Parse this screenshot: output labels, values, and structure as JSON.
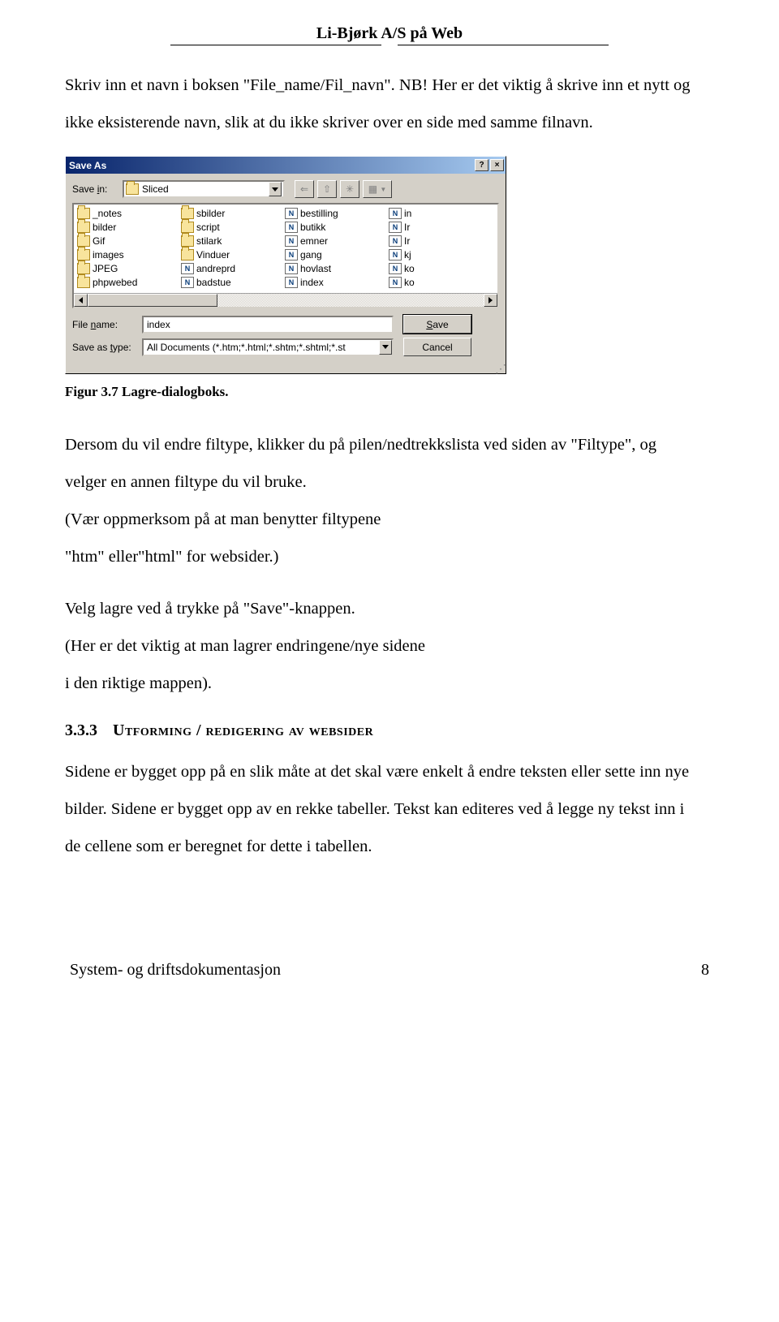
{
  "header": {
    "title": "Li-Bjørk A/S på Web"
  },
  "intro": {
    "p1": "Skriv inn et navn i boksen \"File_name/Fil_navn\". NB! Her er det viktig å skrive inn et nytt og",
    "p2": "ikke eksisterende navn, slik at du ikke skriver over en side med samme filnavn."
  },
  "dialog": {
    "title": "Save As",
    "help": "?",
    "close": "×",
    "savein_label_pre": "Save ",
    "savein_label_u": "i",
    "savein_label_post": "n:",
    "savein_value": "Sliced",
    "toolbar": {
      "back": "⇐",
      "up": "⇧",
      "new": "✳",
      "view": "▦"
    },
    "cols": [
      [
        {
          "t": "folder",
          "n": "_notes"
        },
        {
          "t": "folder",
          "n": "bilder"
        },
        {
          "t": "folder",
          "n": "Gif"
        },
        {
          "t": "folder",
          "n": "images"
        },
        {
          "t": "folder",
          "n": "JPEG"
        },
        {
          "t": "folder",
          "n": "phpwebed"
        }
      ],
      [
        {
          "t": "folder",
          "n": "sbilder"
        },
        {
          "t": "folder",
          "n": "script"
        },
        {
          "t": "folder",
          "n": "stilark"
        },
        {
          "t": "folder",
          "n": "Vinduer"
        },
        {
          "t": "file",
          "n": "andreprd"
        },
        {
          "t": "file",
          "n": "badstue"
        }
      ],
      [
        {
          "t": "file",
          "n": "bestilling"
        },
        {
          "t": "file",
          "n": "butikk"
        },
        {
          "t": "file",
          "n": "emner"
        },
        {
          "t": "file",
          "n": "gang"
        },
        {
          "t": "file",
          "n": "hovlast"
        },
        {
          "t": "file",
          "n": "index"
        }
      ],
      [
        {
          "t": "file",
          "n": "in"
        },
        {
          "t": "file",
          "n": "Ir"
        },
        {
          "t": "file",
          "n": "Ir"
        },
        {
          "t": "file",
          "n": "kj"
        },
        {
          "t": "file",
          "n": "ko"
        },
        {
          "t": "file",
          "n": "ko"
        }
      ]
    ],
    "filename_label_pre": "File ",
    "filename_label_u": "n",
    "filename_label_post": "ame:",
    "filename_value": "index",
    "type_label_pre": "Save as ",
    "type_label_u": "t",
    "type_label_post": "ype:",
    "type_value": "All Documents (*.htm;*.html;*.shtm;*.shtml;*.st",
    "save_btn_u": "S",
    "save_btn_post": "ave",
    "cancel_btn": "Cancel"
  },
  "caption": "Figur 3.7 Lagre-dialogboks.",
  "mid": {
    "p1": "Dersom du vil endre filtype, klikker du på pilen/nedtrekkslista ved siden av \"Filtype\", og",
    "p2": "velger en annen filtype du vil bruke.",
    "p3": "(Vær oppmerksom på at man benytter filtypene",
    "p4": "\"htm\" eller\"html\" for websider.)",
    "p5": "Velg lagre ved å trykke på \"Save\"-knappen.",
    "p6": "(Her er det viktig at man lagrer endringene/nye sidene",
    "p7": "i den riktige mappen)."
  },
  "section": {
    "num": "3.3.3",
    "title": "Utforming / redigering av websider"
  },
  "sectext": {
    "p1": "Sidene er bygget opp på en slik måte at det skal være enkelt å endre teksten eller sette inn nye",
    "p2": "bilder. Sidene er bygget opp av en rekke tabeller. Tekst kan editeres ved å legge ny tekst inn i",
    "p3": "de cellene som er beregnet for dette i tabellen."
  },
  "footer": {
    "left": "System- og driftsdokumentasjon",
    "right": "8"
  }
}
